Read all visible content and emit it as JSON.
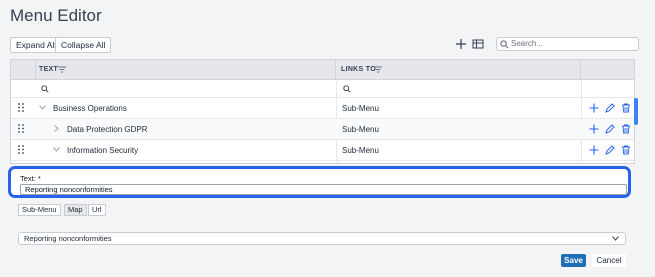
{
  "header": {
    "title": "Menu Editor"
  },
  "toolbar": {
    "expand_all": "Expand All",
    "collapse_all": "Collapse All"
  },
  "search": {
    "placeholder": "Search..."
  },
  "grid": {
    "columns": [
      {
        "label": "TEXT"
      },
      {
        "label": "LINKS TO"
      }
    ],
    "rows": [
      {
        "text": "Business Operations",
        "links_to": "Sub-Menu",
        "expanded": true
      },
      {
        "text": "Data Protection GDPR",
        "links_to": "Sub-Menu",
        "expanded": false
      },
      {
        "text": "Information Security",
        "links_to": "Sub-Menu",
        "expanded": true
      }
    ]
  },
  "editor": {
    "text_label": "Text: *",
    "text_value": "Reporting nonconformities",
    "link_types": [
      "Sub-Menu",
      "Map",
      "Url"
    ],
    "selected_link_type": "Map",
    "map_value": "Reporting nonconformities",
    "save_label": "Save",
    "cancel_label": "Cancel"
  },
  "colors": {
    "accent": "#2563eb",
    "save": "#1e6fb8",
    "icon": "#2563eb"
  }
}
